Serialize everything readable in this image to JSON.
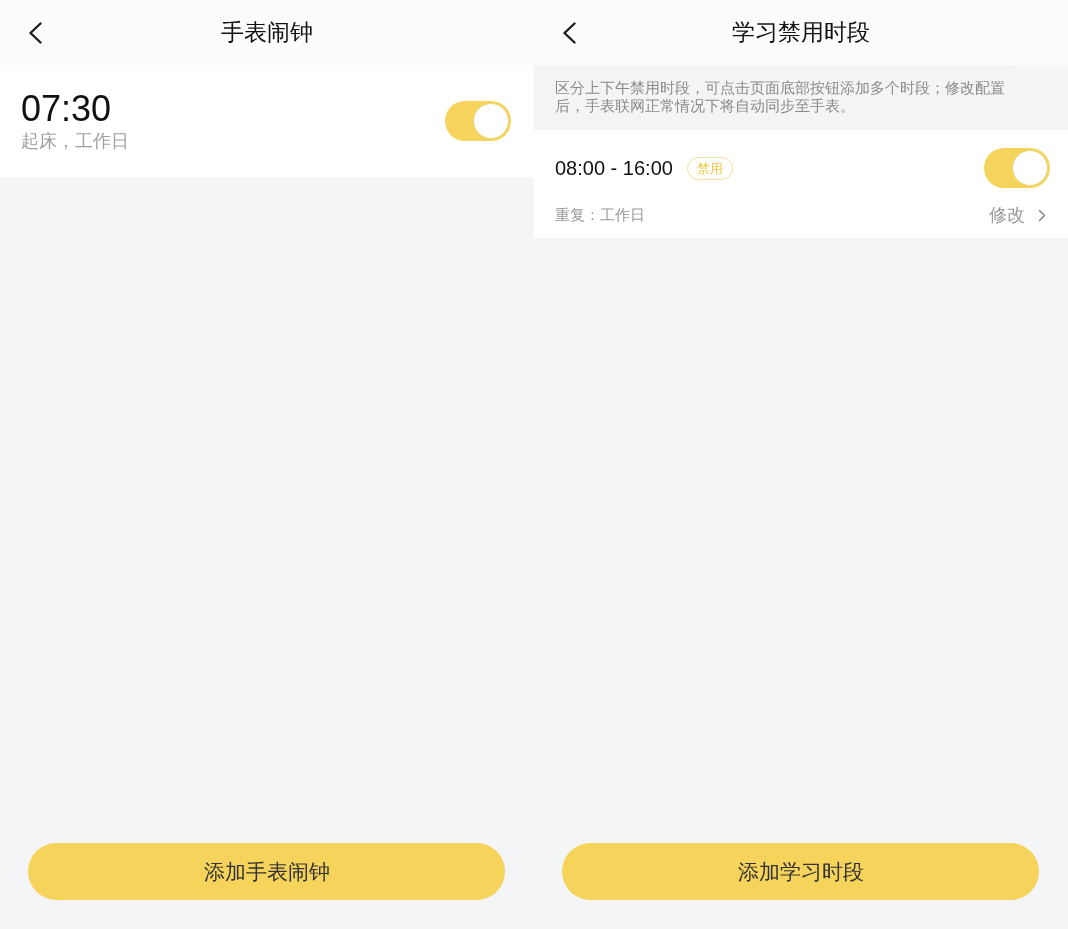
{
  "screens": [
    {
      "kind": "alarm_list",
      "title": "手表闹钟",
      "alarms": [
        {
          "time": "07:30",
          "label": "起床，工作日",
          "on": true
        }
      ],
      "add_button": "添加手表闹钟"
    },
    {
      "kind": "period_list",
      "title": "学习禁用时段",
      "notice": "区分上下午禁用时段，可点击页面底部按钮添加多个时段；修改配置后，手表联网正常情况下将自动同步至手表。",
      "periods": [
        {
          "time_range": "08:00 - 16:00",
          "badge": "禁用",
          "on": true,
          "repeat": "重复：工作日",
          "edit": "修改"
        }
      ],
      "add_button": "添加学习时段"
    }
  ]
}
